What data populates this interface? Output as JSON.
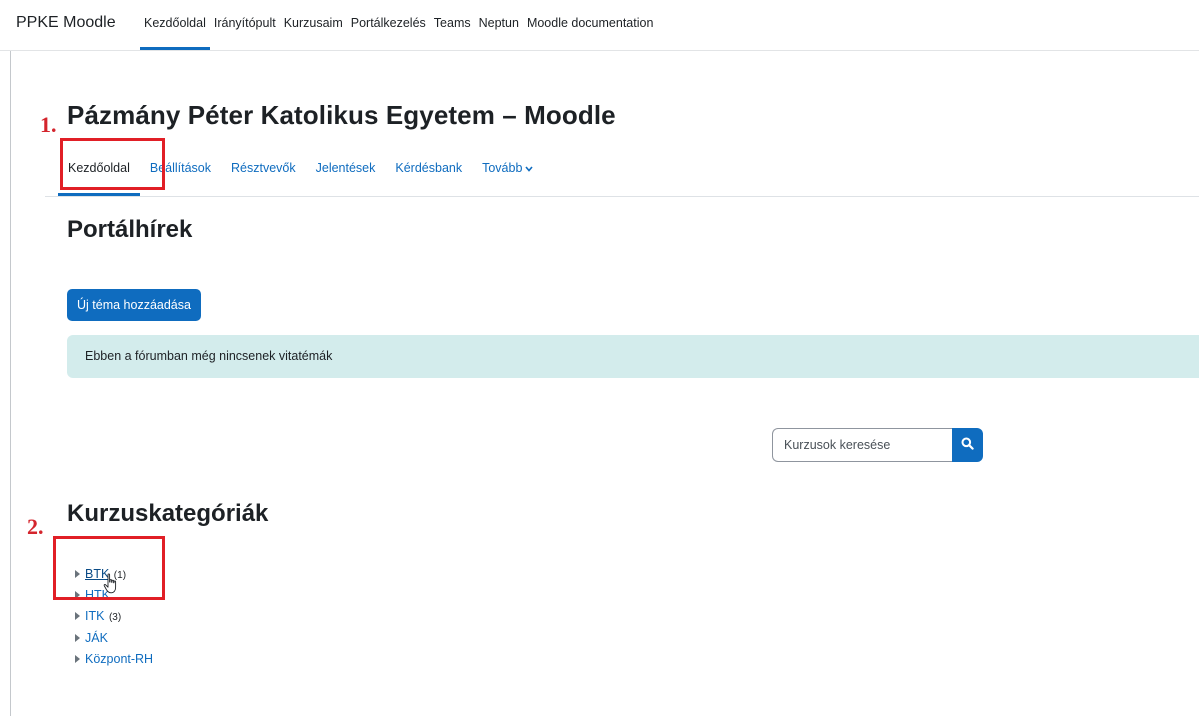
{
  "navbar": {
    "brand": "PPKE Moodle",
    "items": [
      {
        "label": "Kezdőoldal",
        "active": true
      },
      {
        "label": "Irányítópult"
      },
      {
        "label": "Kurzusaim"
      },
      {
        "label": "Portálkezelés"
      },
      {
        "label": "Teams"
      },
      {
        "label": "Neptun"
      },
      {
        "label": "Moodle documentation"
      }
    ]
  },
  "header": {
    "title": "Pázmány Péter Katolikus Egyetem – Moodle"
  },
  "secondary_nav": {
    "items": [
      {
        "label": "Kezdőoldal",
        "active": true
      },
      {
        "label": "Beállítások"
      },
      {
        "label": "Résztvevők"
      },
      {
        "label": "Jelentések"
      },
      {
        "label": "Kérdésbank"
      },
      {
        "label": "Tovább"
      }
    ]
  },
  "annotations": {
    "step1": "1.",
    "step2": "2."
  },
  "news": {
    "title": "Portálhírek",
    "add_button": "Új téma hozzáadása",
    "empty_notice": "Ebben a fórumban még nincsenek vitatémák"
  },
  "search": {
    "placeholder": "Kurzusok keresése"
  },
  "categories": {
    "title": "Kurzuskategóriák",
    "items": [
      {
        "name": "BTK",
        "count": "(1)"
      },
      {
        "name": "HTK",
        "count": ""
      },
      {
        "name": "ITK",
        "count": "(3)"
      },
      {
        "name": "JÁK",
        "count": ""
      },
      {
        "name": "Központ-RH",
        "count": ""
      }
    ]
  },
  "colors": {
    "primary": "#0f6cbf",
    "info_bg": "#d3ecec",
    "annotation_red": "#e11f26"
  },
  "icons": {
    "search": "search-icon",
    "expand": "triangle-right-icon",
    "more": "chevron-down-icon",
    "cursor": "hand-pointer-icon"
  }
}
